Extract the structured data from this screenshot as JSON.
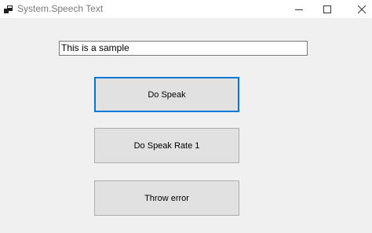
{
  "window": {
    "title": "System.Speech Text",
    "minimize_icon": "minimize-icon",
    "maximize_icon": "maximize-icon",
    "close_icon": "close-icon"
  },
  "form": {
    "text_input_value": "This is a sample",
    "buttons": [
      {
        "label": "Do Speak",
        "focused": true
      },
      {
        "label": "Do Speak Rate 1",
        "focused": false
      },
      {
        "label": "Throw error",
        "focused": false
      }
    ]
  },
  "colors": {
    "focus_accent": "#0078d7",
    "button_face": "#e1e1e1",
    "form_background": "#f0f0f0"
  }
}
